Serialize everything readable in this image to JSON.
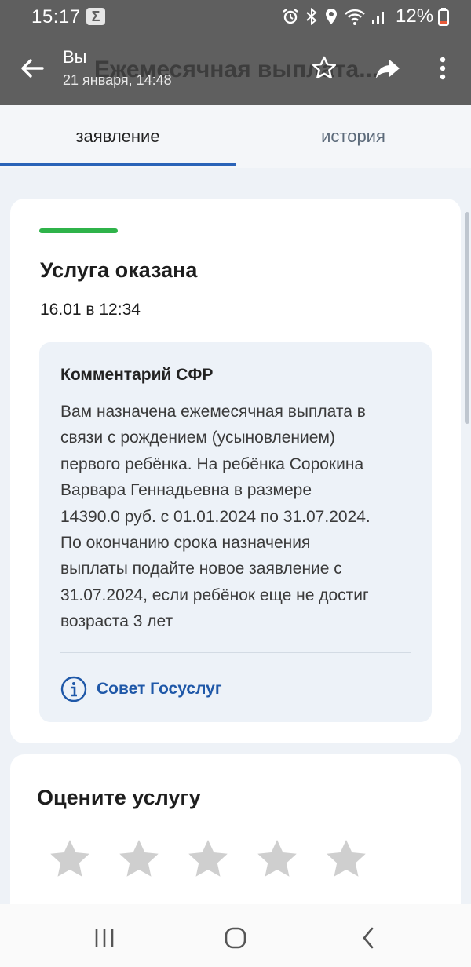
{
  "status_bar": {
    "time": "15:17",
    "sigma": "Σ",
    "battery": "12%"
  },
  "app_bar": {
    "background_title": "Ежемесячная выплата...",
    "sender": "Вы",
    "date": "21 января, 14:48",
    "icons": [
      "back-arrow-icon",
      "star-icon",
      "share-icon",
      "more-vert-icon"
    ]
  },
  "tabs": [
    {
      "label": "заявление",
      "active": true
    },
    {
      "label": "история",
      "active": false
    }
  ],
  "status_card": {
    "title": "Услуга оказана",
    "date": "16.01 в 12:34",
    "status_color": "#2fb34a",
    "comment": {
      "heading": "Комментарий СФР",
      "lines": [
        "Вам назначена ежемесячная выплата в",
        "связи с рождением (усыновлением)",
        "первого ребёнка. На ребёнка Сорокина",
        "Варвара Геннадьевна в размере",
        "14390.0 руб. с 01.01.2024 по 31.07.2024.",
        "По окончанию срока назначения",
        "выплаты подайте новое заявление с",
        "31.07.2024, если ребёнок еще не достиг",
        "возраста 3 лет"
      ],
      "advice_label": "Совет Госуслуг"
    }
  },
  "rating": {
    "title": "Оцените услугу",
    "stars_total": 5,
    "stars_selected": 0
  },
  "colors": {
    "accent": "#2a63b8",
    "link": "#1f58a8",
    "success": "#2fb34a",
    "appbar": "#5f5f5f"
  }
}
